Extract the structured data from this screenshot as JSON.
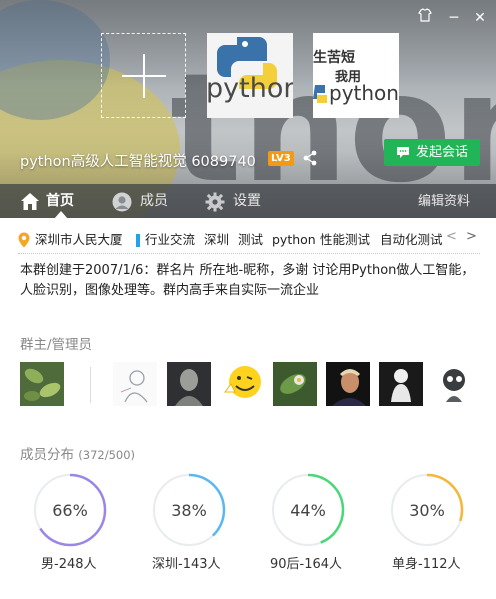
{
  "window": {
    "skin_icon": "shirt-icon",
    "minimize_label": "─",
    "close_label": "✕"
  },
  "header": {
    "group_name": "python高级人工智能视觉 6089740",
    "level_badge": "LV3",
    "chat_button": "发起会话",
    "thumb2_lines": [
      "生苦短",
      "我用"
    ],
    "thumb1_word": "python",
    "thumb2_word": "python"
  },
  "tabs": [
    {
      "label": "首页",
      "icon": "home-icon",
      "active": true
    },
    {
      "label": "成员",
      "icon": "user-icon",
      "active": false
    },
    {
      "label": "设置",
      "icon": "gear-icon",
      "active": false
    }
  ],
  "edit_profile": "编辑资料",
  "location": "深圳市人民大厦",
  "tags": [
    "行业交流",
    "深圳",
    "测试",
    "python",
    "性能测试",
    "自动化测试"
  ],
  "tag_nav": {
    "prev": "<",
    "next": ">"
  },
  "description": "本群创建于2007/1/6：群名片 所在地-昵称，多谢 讨论用Python做人工智能，人脸识别，图像处理等。群内高手来自实际一流企业",
  "admins_title": "群主/管理员",
  "admin_avatars": [
    "avatar-leaves",
    "avatar-sketch",
    "avatar-statue",
    "avatar-smiley",
    "avatar-flower",
    "avatar-portrait",
    "avatar-figurine",
    "avatar-cartoon"
  ],
  "members_title": "成员分布",
  "members_count": "(372/500)",
  "stats": [
    {
      "percent": "66%",
      "value": 0.66,
      "label": "男-248人",
      "color": "#9b86e8"
    },
    {
      "percent": "38%",
      "value": 0.38,
      "label": "深圳-143人",
      "color": "#5ab8f0"
    },
    {
      "percent": "44%",
      "value": 0.44,
      "label": "90后-164人",
      "color": "#48d877"
    },
    {
      "percent": "30%",
      "value": 0.3,
      "label": "单身-112人",
      "color": "#f5b63a"
    }
  ]
}
